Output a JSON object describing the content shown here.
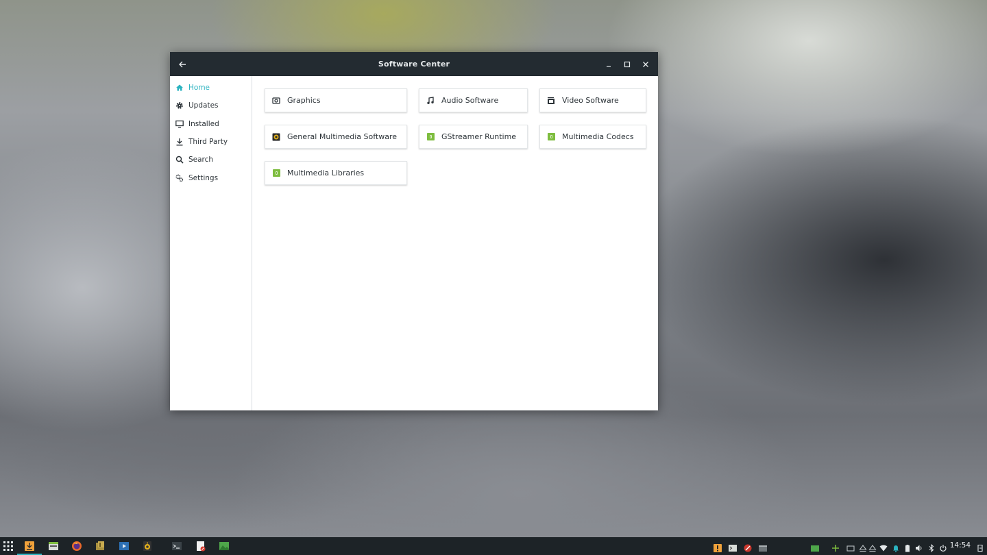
{
  "window": {
    "title": "Software Center"
  },
  "sidebar": {
    "items": [
      {
        "label": "Home",
        "icon": "home-icon",
        "active": true
      },
      {
        "label": "Updates",
        "icon": "gear-icon",
        "active": false
      },
      {
        "label": "Installed",
        "icon": "monitor-icon",
        "active": false
      },
      {
        "label": "Third Party",
        "icon": "download-icon",
        "active": false
      },
      {
        "label": "Search",
        "icon": "search-icon",
        "active": false
      },
      {
        "label": "Settings",
        "icon": "settings-icon",
        "active": false
      }
    ]
  },
  "categories": [
    {
      "label": "Graphics",
      "icon": "camera-icon"
    },
    {
      "label": "Audio Software",
      "icon": "music-note-icon"
    },
    {
      "label": "Video Software",
      "icon": "video-icon"
    },
    {
      "label": "General Multimedia Software",
      "icon": "speaker-icon"
    },
    {
      "label": "GStreamer Runtime",
      "icon": "package-icon"
    },
    {
      "label": "Multimedia Codecs",
      "icon": "package-icon"
    },
    {
      "label": "Multimedia Libraries",
      "icon": "package-icon"
    }
  ],
  "taskbar": {
    "clock": "14:54"
  },
  "colors": {
    "accent": "#2bb3c0",
    "titlebar": "#232b31",
    "taskbar": "#1d2327",
    "package_green": "#7ebd3f"
  }
}
